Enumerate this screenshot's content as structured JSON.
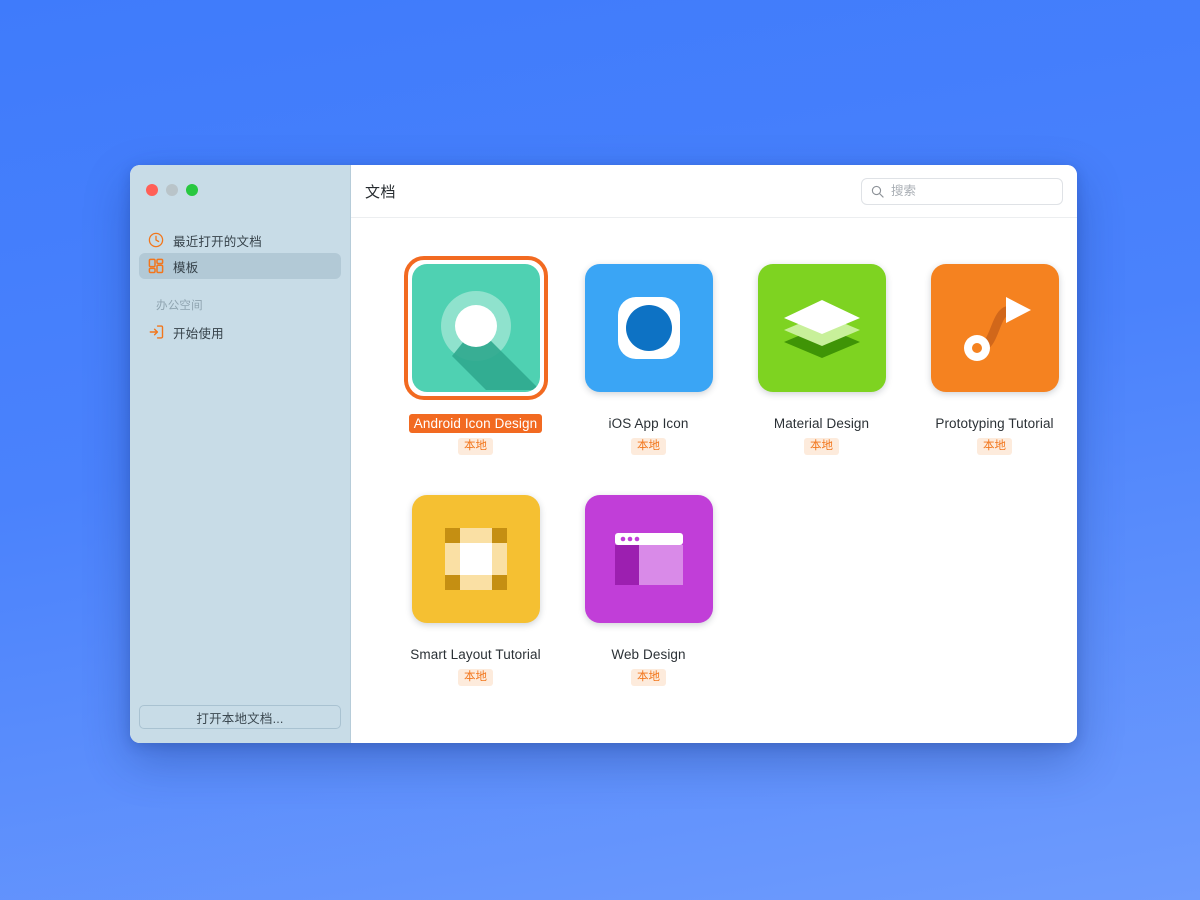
{
  "window": {
    "traffic_lights": [
      {
        "name": "close",
        "color": "#ff5f57"
      },
      {
        "name": "minimize",
        "color": "#b9c4c9"
      },
      {
        "name": "zoom",
        "color": "#28c840"
      }
    ]
  },
  "sidebar": {
    "items": [
      {
        "label": "最近打开的文档",
        "icon": "clock-icon",
        "selected": false
      },
      {
        "label": "模板",
        "icon": "template-icon",
        "selected": true
      }
    ],
    "section_title": "办公空间",
    "workspace_items": [
      {
        "label": "开始使用",
        "icon": "sign-in-icon",
        "selected": false
      }
    ],
    "footer_button": "打开本地文档...",
    "accent_color": "#f2761c",
    "background_color": "#c8dce7",
    "selected_background": "#b2c9d6"
  },
  "header": {
    "title": "文档",
    "search": {
      "placeholder": "搜索",
      "value": "",
      "icon": "search-icon"
    }
  },
  "main": {
    "badge_label": "本地",
    "selected_accent": "#f26a21",
    "templates": [
      {
        "name": "Android Icon Design",
        "badge": "本地",
        "selected": true,
        "art": "android-icon-art",
        "color": "#4fd1b2"
      },
      {
        "name": "iOS App Icon",
        "badge": "本地",
        "selected": false,
        "art": "ios-app-icon-art",
        "color": "#3aa5f5"
      },
      {
        "name": "Material Design",
        "badge": "本地",
        "selected": false,
        "art": "material-design-art",
        "color": "#7ed321"
      },
      {
        "name": "Prototyping Tutorial",
        "badge": "本地",
        "selected": false,
        "art": "prototyping-art",
        "color": "#f58220"
      },
      {
        "name": "Smart Layout Tutorial",
        "badge": "本地",
        "selected": false,
        "art": "smart-layout-art",
        "color": "#f5c032"
      },
      {
        "name": "Web Design",
        "badge": "本地",
        "selected": false,
        "art": "web-design-art",
        "color": "#c martin"
      }
    ]
  }
}
